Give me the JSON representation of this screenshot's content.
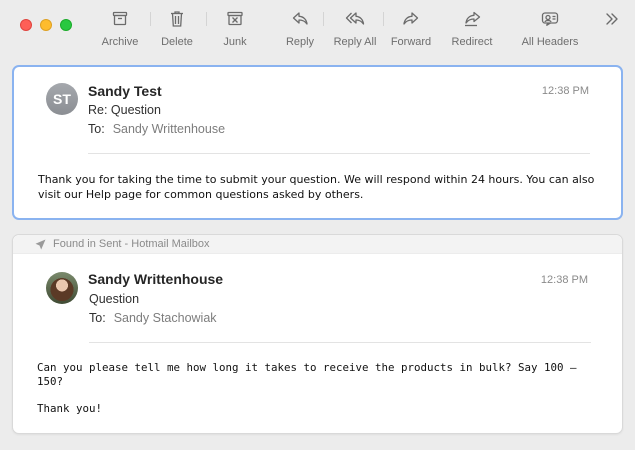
{
  "toolbar": {
    "buttons": [
      {
        "label": "Archive",
        "icon": "archive-icon"
      },
      {
        "label": "Delete",
        "icon": "trash-icon"
      },
      {
        "label": "Junk",
        "icon": "junk-icon"
      },
      {
        "label": "Reply",
        "icon": "reply-icon"
      },
      {
        "label": "Reply All",
        "icon": "reply-all-icon"
      },
      {
        "label": "Forward",
        "icon": "forward-icon"
      },
      {
        "label": "Redirect",
        "icon": "redirect-icon"
      },
      {
        "label": "All Headers",
        "icon": "all-headers-icon"
      }
    ],
    "overflow_icon": "chevron-double-right-icon"
  },
  "messages": [
    {
      "avatar_initials": "ST",
      "sender": "Sandy Test",
      "subject": "Re: Question",
      "to_label": "To:",
      "to": "Sandy Writtenhouse",
      "time": "12:38 PM",
      "body": "Thank you for taking the time to submit your question. We will respond within 24 hours. You can also visit our Help page for common questions asked by others."
    },
    {
      "found_in": "Found in Sent - Hotmail Mailbox",
      "sender": "Sandy Writtenhouse",
      "subject": "Question",
      "to_label": "To:",
      "to": "Sandy Stachowiak",
      "time": "12:38 PM",
      "body_p1": "Can you please tell me how long it takes to receive the products in bulk? Say 100 – 150?",
      "body_p2": "Thank you!"
    }
  ],
  "colors": {
    "selection_border": "#8ab3f0",
    "close": "#fe5f57",
    "minimize": "#febc2e",
    "zoom": "#28c840"
  }
}
